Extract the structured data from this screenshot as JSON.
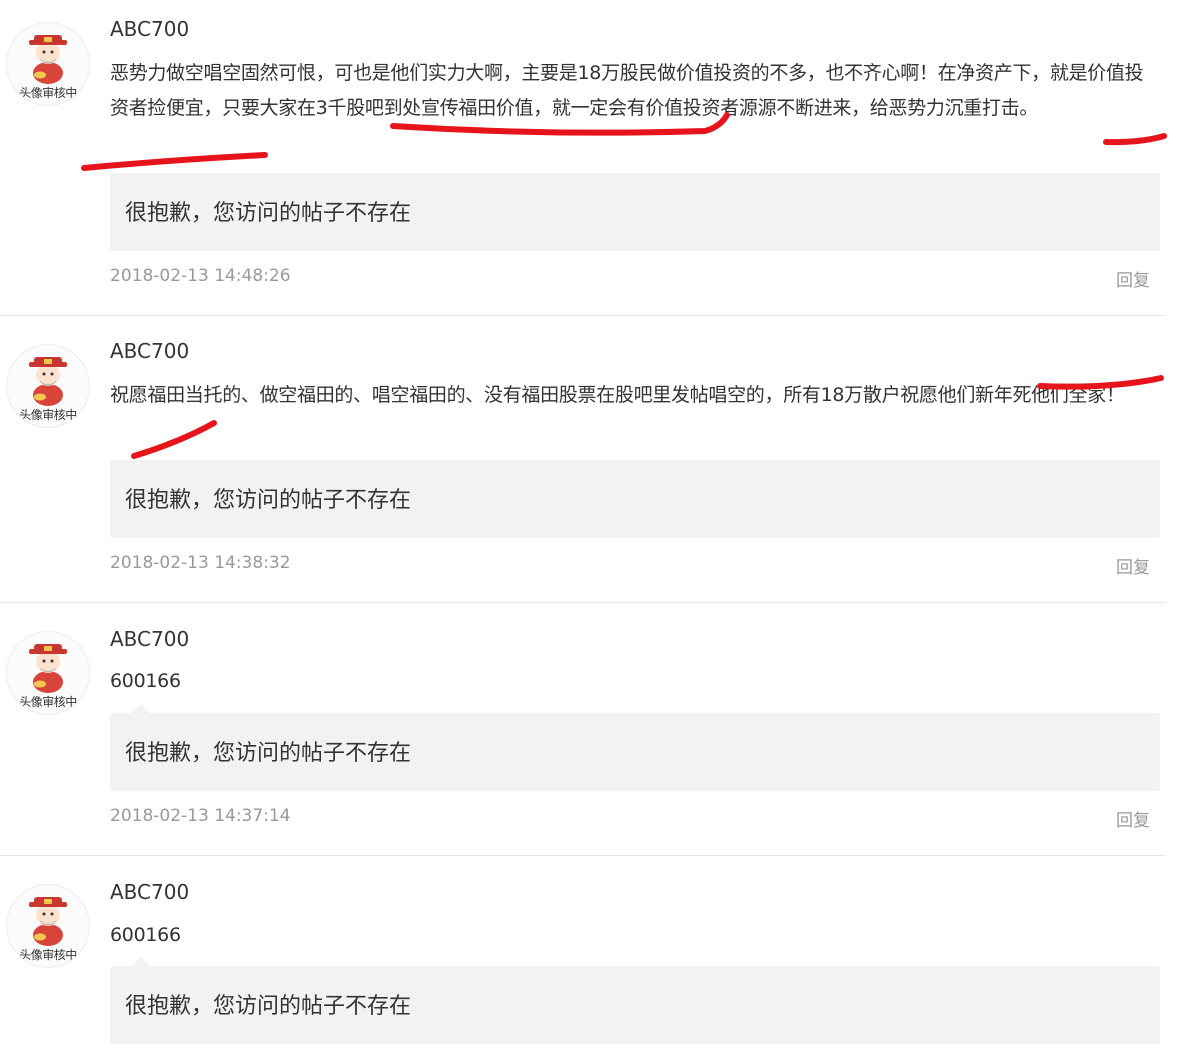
{
  "posts": [
    {
      "username": "ABC700",
      "text": "恶势力做空唱空固然可恨，可也是他们实力大啊，主要是18万股民做价值投资的不多，也不齐心啊！在净资产下，就是价值投资者捡便宜，只要大家在3千股吧到处宣传福田价值，就一定会有价值投资者源源不断进来，给恶势力沉重打击。",
      "quote": "很抱歉，您访问的帖子不存在",
      "time": "2018-02-13 14:48:26",
      "reply": "回复",
      "avatar_caption": "头像审核中"
    },
    {
      "username": "ABC700",
      "text": "祝愿福田当托的、做空福田的、唱空福田的、没有福田股票在股吧里发帖唱空的，所有18万散户祝愿他们新年死他们全家！",
      "quote": "很抱歉，您访问的帖子不存在",
      "time": "2018-02-13 14:38:32",
      "reply": "回复",
      "avatar_caption": "头像审核中"
    },
    {
      "username": "ABC700",
      "text": "600166",
      "quote": "很抱歉，您访问的帖子不存在",
      "time": "2018-02-13 14:37:14",
      "reply": "回复",
      "avatar_caption": "头像审核中"
    },
    {
      "username": "ABC700",
      "text": "600166",
      "quote": "很抱歉，您访问的帖子不存在",
      "time": "",
      "reply": "",
      "avatar_caption": "头像审核中"
    }
  ],
  "colors": {
    "annotation": "#e8141b",
    "quote_bg": "#f2f2f2",
    "meta": "#999999",
    "text": "#333333",
    "divider": "#e6e6e6"
  },
  "icons": {
    "avatar": "cartoon-god-of-wealth-avatar-icon"
  }
}
